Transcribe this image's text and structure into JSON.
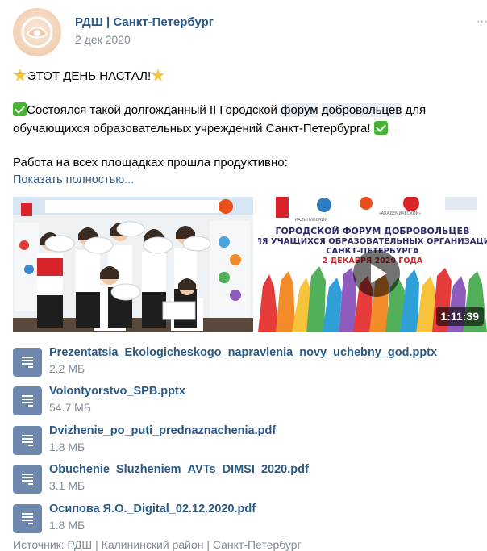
{
  "header": {
    "author": "РДШ | Санкт-Петербург",
    "date": "2 дек 2020"
  },
  "text": {
    "line1": "ЭТОТ ДЕНЬ НАСТАЛ!",
    "line2_before": "Состоялся такой долгожданный II Городской ",
    "line2_hl1": "форум",
    "line2_mid": " ",
    "line2_hl2": "добровольцев",
    "line2_after": " для",
    "line3": "обучающихся образовательных учреждений Санкт-Петербурга! ",
    "line4": "Работа на всех площадках прошла продуктивно:",
    "show_more": "Показать полностью..."
  },
  "video": {
    "banner_line1": "ГОРОДСКОЙ ФОРУМ ДОБРОВОЛЬЦЕВ",
    "banner_line2": "ДЛЯ УЧАЩИХСЯ ОБРАЗОВАТЕЛЬНЫХ ОРГАНИЗАЦИЙ",
    "banner_line3": "САНКТ-ПЕТЕРБУРГА",
    "banner_date": "2 ДЕКАБРЯ 2020 ГОДА",
    "logo1": "КАЛИНИНСКИЙ",
    "logo2": "«АКАДЕМИЧЕСКИЙ»",
    "duration": "1:11:39"
  },
  "photo": {
    "banner_text": "ДЛЯ УЧАЩИХСЯ ОБРАЗОВАТЕЛЬНЫХ ОРГАНИЗАЦИЙ"
  },
  "documents": [
    {
      "title": "Prezentatsia_Ekologicheskogo_napravlenia_novy_uchebny_god.pptx",
      "size": "2.2 МБ"
    },
    {
      "title": "Volontyorstvo_SPB.pptx",
      "size": "54.7 МБ"
    },
    {
      "title": "Dvizhenie_po_puti_prednaznachenia.pdf",
      "size": "1.8 МБ"
    },
    {
      "title": "Obuchenie_Sluzheniem_AVTs_DIMSI_2020.pdf",
      "size": "3.1 МБ"
    },
    {
      "title": "Осипова Я.О._Digital_02.12.2020.pdf",
      "size": "1.8 МБ"
    }
  ],
  "source": "Источник: РДШ | Калининский район | Санкт-Петербург",
  "colors": {
    "link": "#2a5885",
    "secondary": "#818c99",
    "doc_icon": "#6d87ad",
    "check": "#45b431"
  }
}
